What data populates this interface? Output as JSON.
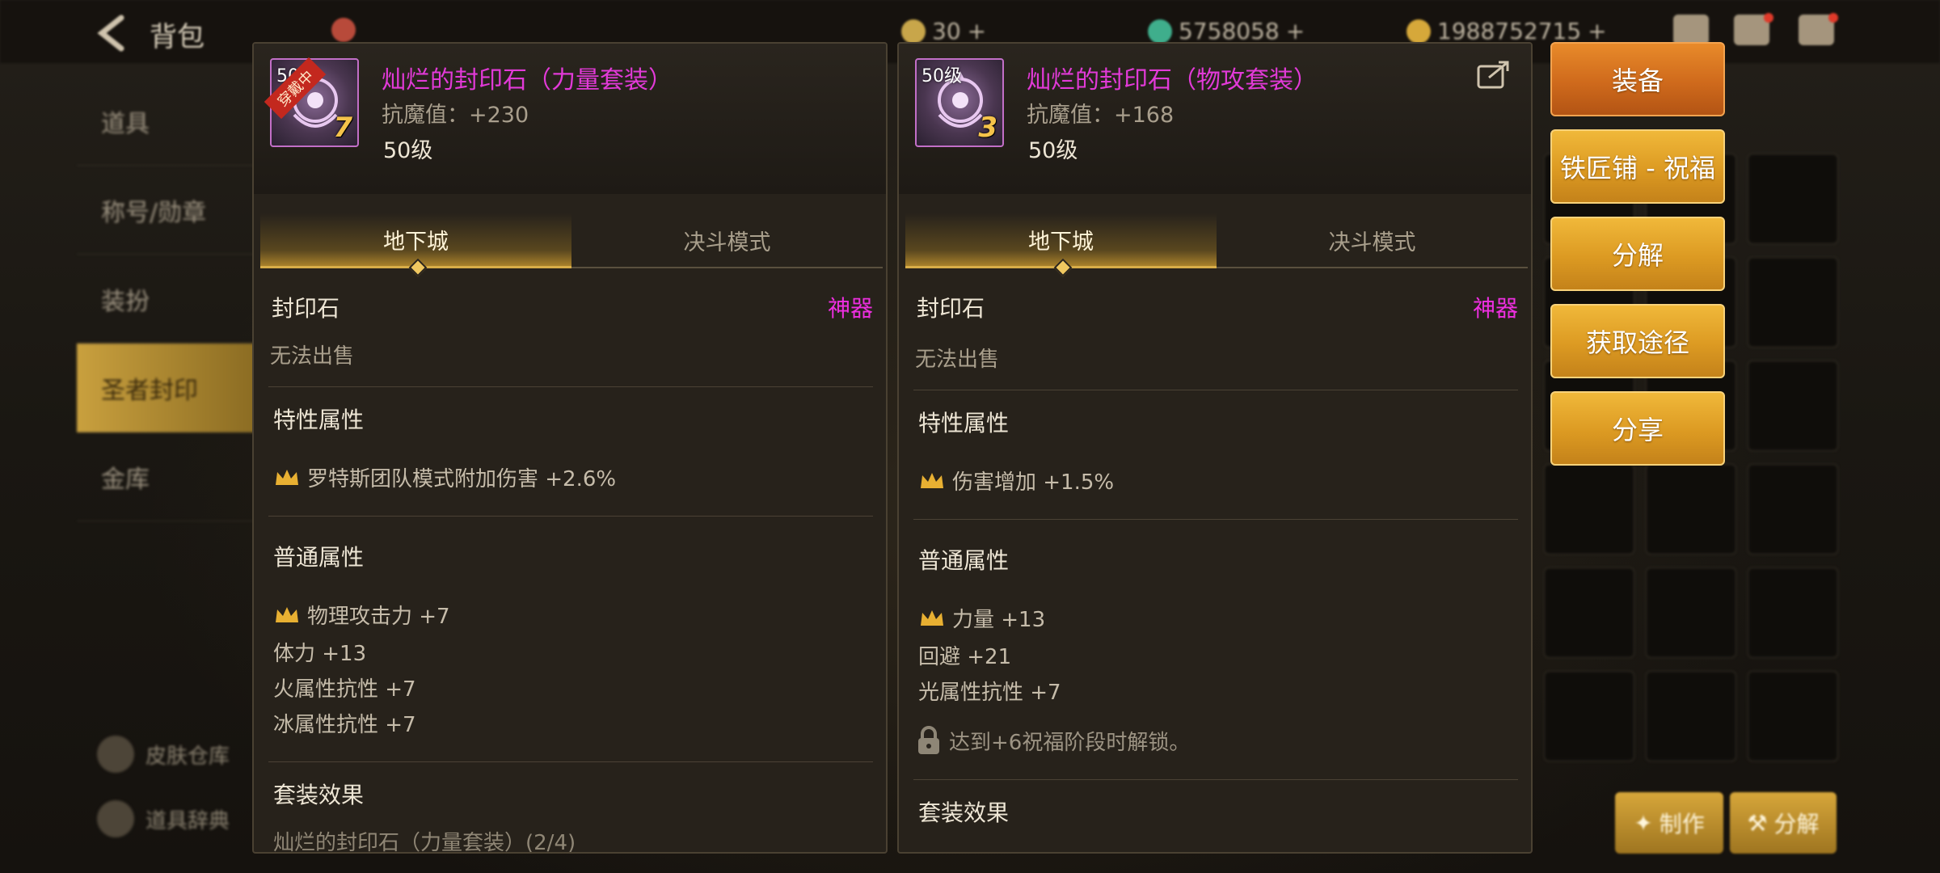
{
  "topbar": {
    "title": "背包",
    "resources": [
      {
        "value": "30",
        "color": "#c8a64a"
      },
      {
        "value": "5758058",
        "color": "#3fae8c"
      },
      {
        "value": "1988752715",
        "color": "#d6a83a"
      }
    ]
  },
  "leftnav": {
    "items": [
      "道具",
      "称号/勋章",
      "装扮",
      "圣者封印",
      "金库"
    ],
    "active": "圣者封印",
    "bottom": [
      "皮肤仓库",
      "道具辞典"
    ]
  },
  "panel_left": {
    "level_badge": "50级",
    "equipped_badge": "穿戴中",
    "enhance": "7",
    "name": "灿烂的封印石（力量套装）",
    "stat": "抗魔值：+230",
    "level": "50级",
    "tabs": [
      "地下城",
      "决斗模式"
    ],
    "type": "封印石",
    "rarity": "神器",
    "sell": "无法出售",
    "special_title": "特性属性",
    "special_attrs": [
      "罗特斯团队模式附加伤害 +2.6%"
    ],
    "normal_title": "普通属性",
    "normal_attrs": [
      {
        "text": "物理攻击力 +7",
        "crown": true
      },
      {
        "text": "体力 +13",
        "crown": false
      },
      {
        "text": "火属性抗性 +7",
        "crown": false
      },
      {
        "text": "冰属性抗性 +7",
        "crown": false
      }
    ],
    "set_title": "套装效果",
    "set_line": "灿烂的封印石（力量套装）(2/4)"
  },
  "panel_right": {
    "level_badge": "50级",
    "enhance": "3",
    "name": "灿烂的封印石（物攻套装）",
    "stat": "抗魔值：+168",
    "level": "50级",
    "tabs": [
      "地下城",
      "决斗模式"
    ],
    "type": "封印石",
    "rarity": "神器",
    "sell": "无法出售",
    "special_title": "特性属性",
    "special_attrs": [
      "伤害增加 +1.5%"
    ],
    "normal_title": "普通属性",
    "normal_attrs": [
      {
        "text": "力量 +13",
        "crown": true
      },
      {
        "text": "回避 +21",
        "crown": false
      },
      {
        "text": "光属性抗性 +7",
        "crown": false
      }
    ],
    "lock_text": "达到+6祝福阶段时解锁。",
    "set_title": "套装效果"
  },
  "actions": [
    "装备",
    "铁匠铺 - 祝福",
    "分解",
    "获取途径",
    "分享"
  ],
  "bottom_buttons": [
    "制作",
    "分解"
  ],
  "colors": {
    "rarity": "#ee2fe0",
    "item_name": "#e23ad8",
    "gold": "#dc9a22"
  }
}
